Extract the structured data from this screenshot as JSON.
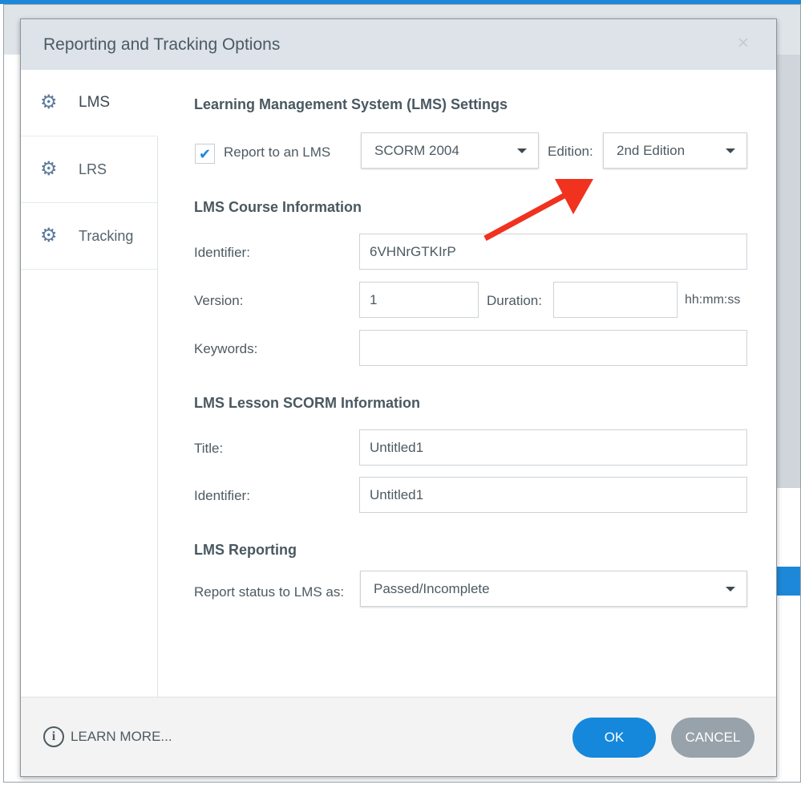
{
  "dialog": {
    "title": "Reporting and Tracking Options",
    "close_icon": "×"
  },
  "sidebar": {
    "items": [
      {
        "label": "LMS",
        "active": true
      },
      {
        "label": "LRS"
      },
      {
        "label": "Tracking"
      }
    ]
  },
  "lms_settings": {
    "heading": "Learning Management System (LMS) Settings",
    "report_label": "Report to an LMS",
    "report_checked": true,
    "standard": "SCORM 2004",
    "edition_label": "Edition:",
    "edition": "2nd Edition"
  },
  "course": {
    "heading": "LMS Course Information",
    "identifier_label": "Identifier:",
    "identifier": "6VHNrGTKIrP",
    "version_label": "Version:",
    "version": "1",
    "duration_label": "Duration:",
    "duration": "",
    "duration_unit": "hh:mm:ss",
    "keywords_label": "Keywords:",
    "keywords": ""
  },
  "lesson": {
    "heading": "LMS Lesson SCORM Information",
    "title_label": "Title:",
    "title": "Untitled1",
    "identifier_label": "Identifier:",
    "identifier": "Untitled1"
  },
  "reporting": {
    "heading": "LMS Reporting",
    "status_label": "Report status to LMS as:",
    "status": "Passed/Incomplete"
  },
  "footer": {
    "learn_more": "LEARN MORE...",
    "ok": "OK",
    "cancel": "CANCEL"
  },
  "colors": {
    "accent": "#1588dc",
    "annotation_arrow": "#f0321e"
  }
}
